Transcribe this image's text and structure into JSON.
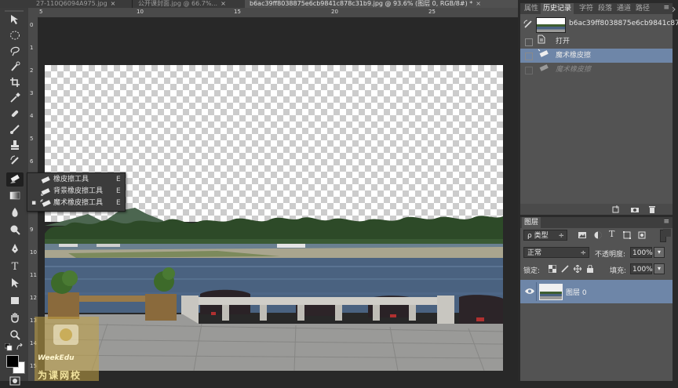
{
  "document_tabs": [
    {
      "label": "27-110Q6094A975.jpg",
      "active": false
    },
    {
      "label": "公开课封面.jpg @ 66.7%...",
      "active": false
    },
    {
      "label": "b6ac39ff8038875e6cb9841c878c31b9.jpg @ 93.6% (图层 0, RGB/8#) *",
      "active": true
    }
  ],
  "tab_close_glyph": "×",
  "ruler": {
    "horizontal": [
      "5",
      "10",
      "15",
      "20",
      "25"
    ],
    "vertical": [
      "0",
      "1",
      "2",
      "3",
      "4",
      "5",
      "6",
      "7",
      "8",
      "9",
      "10",
      "11",
      "12",
      "13",
      "14",
      "15"
    ]
  },
  "tools": [
    "move-tool-icon",
    "marquee-tool-icon",
    "lasso-tool-icon",
    "quick-selection-tool-icon",
    "crop-tool-icon",
    "eyedropper-tool-icon",
    "healing-brush-tool-icon",
    "brush-tool-icon",
    "clone-stamp-tool-icon",
    "history-brush-tool-icon",
    "eraser-tool-icon",
    "gradient-tool-icon",
    "blur-tool-icon",
    "dodge-tool-icon",
    "pen-tool-icon",
    "type-tool-icon",
    "path-selection-tool-icon",
    "rectangle-tool-icon",
    "hand-tool-icon",
    "zoom-tool-icon"
  ],
  "type_tool_glyph": "T",
  "flyout": {
    "items": [
      {
        "label": "橡皮擦工具",
        "key": "E",
        "active": false
      },
      {
        "label": "背景橡皮擦工具",
        "key": "E",
        "active": false
      },
      {
        "label": "魔术橡皮擦工具",
        "key": "E",
        "active": true
      }
    ],
    "bullet": "▪"
  },
  "history_panel": {
    "tabs": [
      {
        "label": "属性",
        "active": false
      },
      {
        "label": "历史记录",
        "active": true
      },
      {
        "label": "字符",
        "active": false
      },
      {
        "label": "段落",
        "active": false
      },
      {
        "label": "通道",
        "active": false
      },
      {
        "label": "路径",
        "active": false
      }
    ],
    "snapshot_label": "b6ac39ff8038875e6cb9841c87...",
    "items": [
      {
        "label": "打开",
        "selected": false,
        "dimmed": false
      },
      {
        "label": "魔术橡皮擦",
        "selected": true,
        "dimmed": false
      },
      {
        "label": "魔术橡皮擦",
        "selected": false,
        "dimmed": true
      }
    ]
  },
  "layers_panel": {
    "tab_label": "图层",
    "filter_label": "类型",
    "search_glyph": "ρ",
    "blend_mode": "正常",
    "opacity_label": "不透明度:",
    "opacity_value": "100%",
    "lock_label": "锁定:",
    "fill_label": "填充:",
    "fill_value": "100%",
    "filter_icons": [
      "image-filter-icon",
      "adjustment-filter-icon",
      "type-filter-icon",
      "shape-filter-icon",
      "smart-object-filter-icon"
    ],
    "type_filter_glyph": "T",
    "layers": [
      {
        "name": "图层 0",
        "visible": true
      }
    ]
  },
  "panel_menu_glyph": "≡",
  "dropdown_glyph": "÷",
  "stepper_glyph": "▾",
  "watermark": {
    "text": "WeekEdu",
    "cn": "为课网校"
  },
  "colors": {
    "selection_blue": "#6e86a8",
    "panel_bg": "#535353",
    "app_bg": "#282828",
    "sky_checker_light": "#ffffff",
    "sky_checker_dark": "#cccccc",
    "water": "#4a6280"
  }
}
